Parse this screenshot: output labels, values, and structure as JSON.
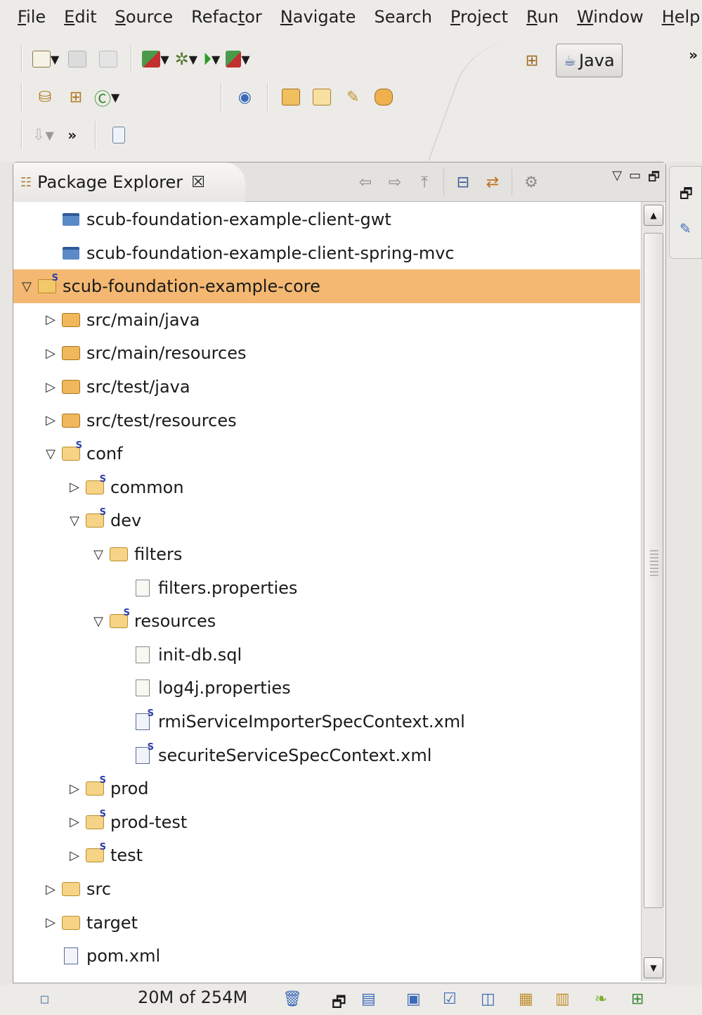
{
  "menubar": {
    "items": [
      {
        "label": "File",
        "mnemonic_index": 0
      },
      {
        "label": "Edit",
        "mnemonic_index": 0
      },
      {
        "label": "Source",
        "mnemonic_index": 0
      },
      {
        "label": "Refactor",
        "mnemonic_index": 5
      },
      {
        "label": "Navigate",
        "mnemonic_index": 0
      },
      {
        "label": "Search",
        "mnemonic_index": -1
      },
      {
        "label": "Project",
        "mnemonic_index": 0
      },
      {
        "label": "Run",
        "mnemonic_index": 0
      },
      {
        "label": "Window",
        "mnemonic_index": 0
      },
      {
        "label": "Help",
        "mnemonic_index": 0
      }
    ]
  },
  "toolbar": {
    "perspective_label": "Java",
    "overflow_chevron": "»",
    "row3_chevron": "»"
  },
  "view": {
    "title": "Package Explorer",
    "close_glyph": "☒"
  },
  "tree": {
    "rows": [
      {
        "label": "scub-foundation-example-client-gwt",
        "indent": 1,
        "twisty": "",
        "icon": "closed-project-icon",
        "selected": false
      },
      {
        "label": "scub-foundation-example-client-spring-mvc",
        "indent": 1,
        "twisty": "",
        "icon": "closed-project-icon",
        "selected": false
      },
      {
        "label": "scub-foundation-example-core",
        "indent": 0,
        "twisty": "expanded",
        "icon": "spring-project-icon",
        "selected": true
      },
      {
        "label": "src/main/java",
        "indent": 1,
        "twisty": "collapsed",
        "icon": "source-folder-icon",
        "selected": false
      },
      {
        "label": "src/main/resources",
        "indent": 1,
        "twisty": "collapsed",
        "icon": "source-folder-icon",
        "selected": false
      },
      {
        "label": "src/test/java",
        "indent": 1,
        "twisty": "collapsed",
        "icon": "source-folder-icon",
        "selected": false
      },
      {
        "label": "src/test/resources",
        "indent": 1,
        "twisty": "collapsed",
        "icon": "source-folder-icon",
        "selected": false
      },
      {
        "label": "conf",
        "indent": 1,
        "twisty": "expanded",
        "icon": "spring-folder-icon",
        "selected": false
      },
      {
        "label": "common",
        "indent": 2,
        "twisty": "collapsed",
        "icon": "spring-folder-icon",
        "selected": false
      },
      {
        "label": "dev",
        "indent": 2,
        "twisty": "expanded",
        "icon": "spring-folder-icon",
        "selected": false
      },
      {
        "label": "filters",
        "indent": 3,
        "twisty": "expanded",
        "icon": "folder-icon",
        "selected": false
      },
      {
        "label": "filters.properties",
        "indent": 4,
        "twisty": "",
        "icon": "properties-file-icon",
        "selected": false
      },
      {
        "label": "resources",
        "indent": 3,
        "twisty": "expanded",
        "icon": "spring-folder-icon",
        "selected": false
      },
      {
        "label": "init-db.sql",
        "indent": 4,
        "twisty": "",
        "icon": "text-file-icon",
        "selected": false
      },
      {
        "label": "log4j.properties",
        "indent": 4,
        "twisty": "",
        "icon": "properties-file-icon",
        "selected": false
      },
      {
        "label": "rmiServiceImporterSpecContext.xml",
        "indent": 4,
        "twisty": "",
        "icon": "spring-xml-file-icon",
        "selected": false
      },
      {
        "label": "securiteServiceSpecContext.xml",
        "indent": 4,
        "twisty": "",
        "icon": "spring-xml-file-icon",
        "selected": false
      },
      {
        "label": "prod",
        "indent": 2,
        "twisty": "collapsed",
        "icon": "spring-folder-icon",
        "selected": false
      },
      {
        "label": "prod-test",
        "indent": 2,
        "twisty": "collapsed",
        "icon": "spring-folder-icon",
        "selected": false
      },
      {
        "label": "test",
        "indent": 2,
        "twisty": "collapsed",
        "icon": "spring-folder-icon",
        "selected": false
      },
      {
        "label": "src",
        "indent": 1,
        "twisty": "collapsed",
        "icon": "folder-icon",
        "selected": false
      },
      {
        "label": "target",
        "indent": 1,
        "twisty": "collapsed",
        "icon": "folder-icon",
        "selected": false
      },
      {
        "label": "pom.xml",
        "indent": 1,
        "twisty": "",
        "icon": "maven-pom-file-icon",
        "selected": false
      }
    ]
  },
  "statusbar": {
    "heap_label": "20M of 254M"
  },
  "colors": {
    "selection": "#f4b872",
    "background": "#edebe7",
    "spring_badge": "#2c3ea8"
  }
}
